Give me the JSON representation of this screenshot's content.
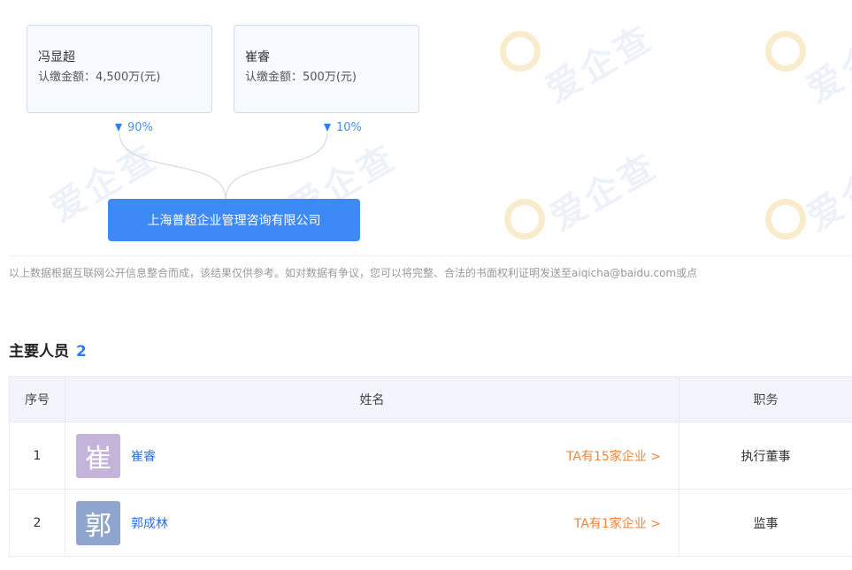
{
  "shareholders": [
    {
      "name": "冯显超",
      "amount": "认缴金额：4,500万(元)",
      "percent": "90%"
    },
    {
      "name": "崔睿",
      "amount": "认缴金额：500万(元)",
      "percent": "10%"
    }
  ],
  "company": {
    "name": "上海普超企业管理咨询有限公司"
  },
  "watermark_text": "爱企查",
  "disclaimer": "以上数据根据互联网公开信息整合而成，该结果仅供参考。如对数据有争议，您可以将完整、合法的书面权利证明发送至aiqicha@baidu.com或点",
  "personnel": {
    "title": "主要人员",
    "count": "2",
    "headers": {
      "index": "序号",
      "name": "姓名",
      "position": "职务"
    },
    "rows": [
      {
        "index": "1",
        "avatar_char": "崔",
        "avatar_color": "#c4b4d9",
        "name": "崔睿",
        "link": "TA有15家企业 >",
        "position": "执行董事"
      },
      {
        "index": "2",
        "avatar_char": "郭",
        "avatar_color": "#8ea5cd",
        "name": "郭成林",
        "link": "TA有1家企业 >",
        "position": "监事"
      }
    ]
  }
}
